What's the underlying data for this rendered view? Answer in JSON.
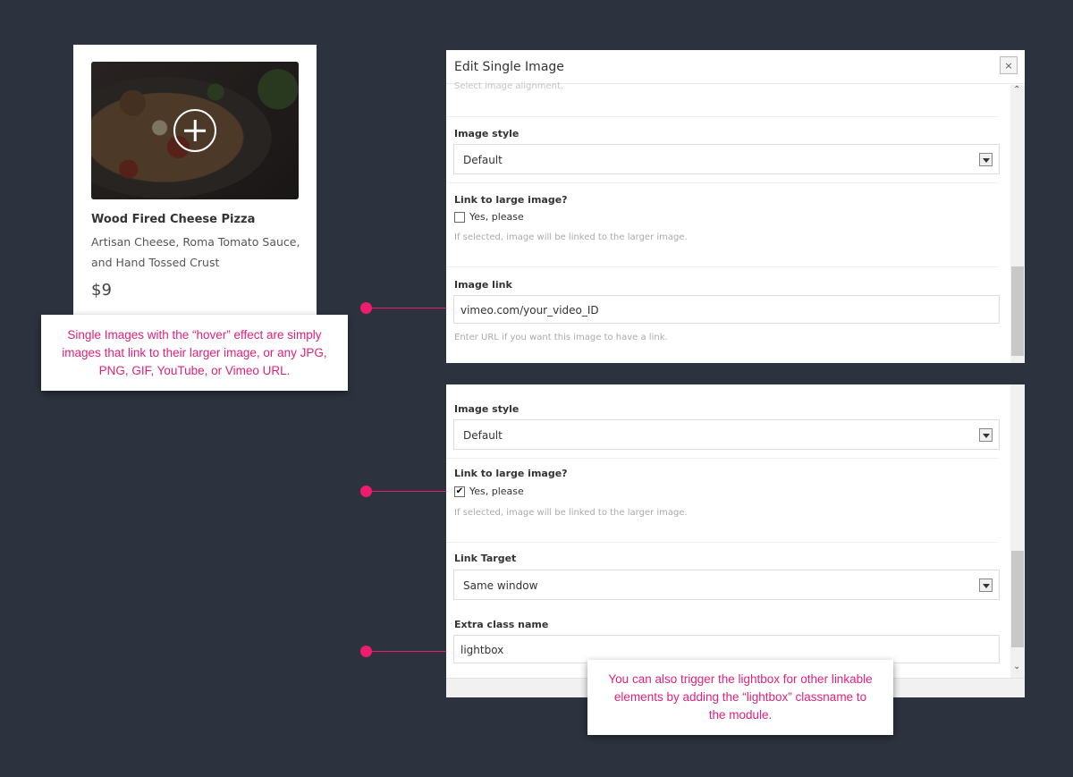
{
  "card": {
    "title": "Wood Fired Cheese Pizza",
    "description": "Artisan Cheese, Roma Tomato Sauce, and Hand Tossed Crust",
    "price": "$9"
  },
  "callouts": {
    "first": "Single Images with the “hover” effect are simply images that link to their larger image, or any JPG, PNG, GIF, YouTube, or Vimeo URL.",
    "second": "You can also trigger the lightbox for other linkable elements by adding the “lightbox” classname to the module."
  },
  "panel1": {
    "title": "Edit Single Image",
    "close_label": "×",
    "alignment_hint": "Select image alignment.",
    "image_style_label": "Image style",
    "image_style_value": "Default",
    "link_large_label": "Link to large image?",
    "checkbox_label": "Yes, please",
    "checkbox_checked": false,
    "link_large_hint": "If selected, image will be linked to the larger image.",
    "image_link_label": "Image link",
    "image_link_value": "vimeo.com/your_video_ID",
    "image_link_hint": "Enter URL if you want this image to have a link."
  },
  "panel2": {
    "image_style_label": "Image style",
    "image_style_value": "Default",
    "link_large_label": "Link to large image?",
    "checkbox_label": "Yes, please",
    "checkbox_checked": true,
    "checkmark": "✔",
    "link_large_hint": "If selected, image will be linked to the larger image.",
    "link_target_label": "Link Target",
    "link_target_value": "Same window",
    "extra_class_label": "Extra class name",
    "extra_class_value": "lightbox"
  },
  "colors": {
    "background": "#2d333e",
    "accent": "#ef1b6c",
    "callout_text": "#e0217a"
  }
}
